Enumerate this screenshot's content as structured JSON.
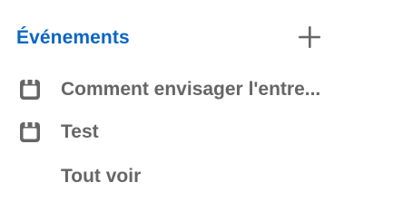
{
  "section": {
    "title": "Événements",
    "add_icon": "plus-icon"
  },
  "events": [
    {
      "label": "Comment envisager l'entre...",
      "icon": "calendar-icon"
    },
    {
      "label": "Test",
      "icon": "calendar-icon"
    }
  ],
  "see_all_label": "Tout voir",
  "colors": {
    "accent": "#0a66c2",
    "text": "#666666",
    "icon": "#666666"
  }
}
